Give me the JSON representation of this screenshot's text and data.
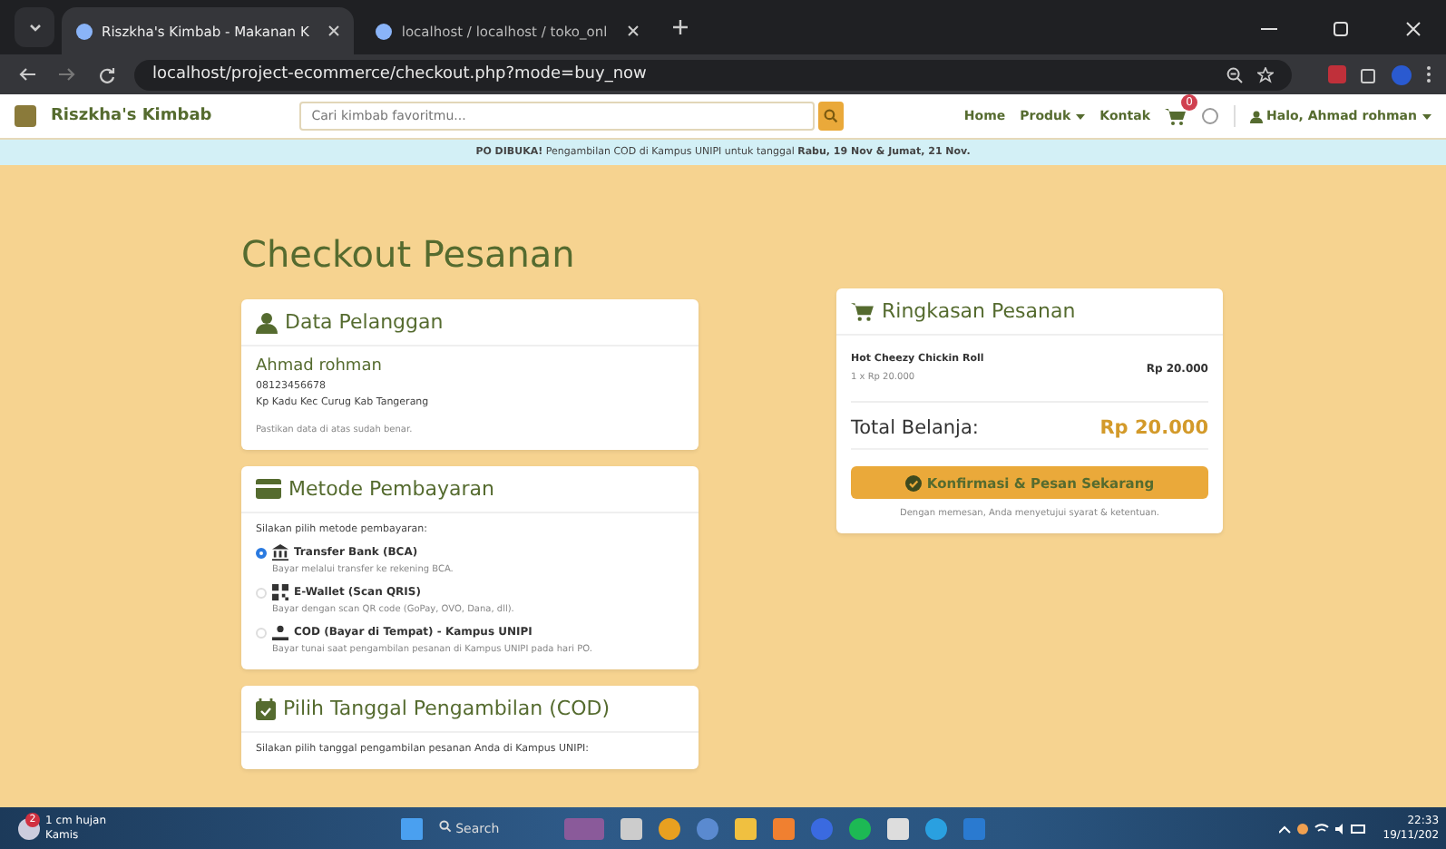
{
  "browser": {
    "tabs": [
      {
        "title": "Riszkha's Kimbab - Makanan K",
        "selected": true
      },
      {
        "title": "localhost / localhost / toko_onl",
        "selected": false
      }
    ],
    "url": "localhost/project-ecommerce/checkout.php?mode=buy_now"
  },
  "navbar": {
    "brand": "Riszkha's Kimbab",
    "search": {
      "placeholder": "Cari kimbab favoritmu..."
    },
    "links": [
      {
        "label": "Home",
        "dropdown": false
      },
      {
        "label": "Produk",
        "dropdown": true
      },
      {
        "label": "Kontak",
        "dropdown": false
      }
    ],
    "cart_badge": "0",
    "user": "Halo, Ahmad rohman"
  },
  "banner": {
    "text": "**PO DIBUKA!** Pengambilan COD di Kampus UNIPI untuk tanggal **Rabu, 19 Nov & Jumat, 21 Nov.**"
  },
  "page_title": "Checkout Pesanan",
  "customer": {
    "title": "Data Pelanggan",
    "name": "Ahmad rohman",
    "phone": "08123456678",
    "address": "Kp Kadu Kec Curug Kab Tangerang",
    "note": "Pastikan data di atas sudah benar."
  },
  "payment": {
    "title": "Metode Pembayaran",
    "intro": "Silakan pilih metode pembayaran:",
    "methods": [
      {
        "kind": "bank",
        "label": "Transfer Bank (BCA)",
        "desc": "Bayar melalui transfer ke rekening BCA.",
        "selected": true
      },
      {
        "kind": "qris",
        "label": "E-Wallet (Scan QRIS)",
        "desc": "Bayar dengan scan QR code (GoPay, OVO, Dana, dll).",
        "selected": false
      },
      {
        "kind": "cod",
        "label": "COD (Bayar di Tempat) - Kampus UNIPI",
        "desc": "Bayar tunai saat pengambilan pesanan di Kampus UNIPI pada hari PO.",
        "selected": false
      }
    ]
  },
  "pickup": {
    "title": "Pilih Tanggal Pengambilan (COD)",
    "intro": "Silakan pilih tanggal pengambilan pesanan Anda di Kampus UNIPI:"
  },
  "summary": {
    "title": "Ringkasan Pesanan",
    "items": [
      {
        "name": "Hot Cheezy Chickin Roll",
        "qty": "1 x Rp 20.000",
        "price": "Rp 20.000"
      }
    ],
    "total_label": "Total Belanja:",
    "total": "Rp 20.000",
    "button": "Konfirmasi & Pesan Sekarang",
    "terms": "Dengan memesan, Anda menyetujui syarat & ketentuan."
  },
  "taskbar": {
    "weather": "1 cm hujan",
    "day": "Kamis",
    "weather_badge": "2",
    "search": "Search",
    "time": "22:33",
    "date": "19/11/202"
  }
}
